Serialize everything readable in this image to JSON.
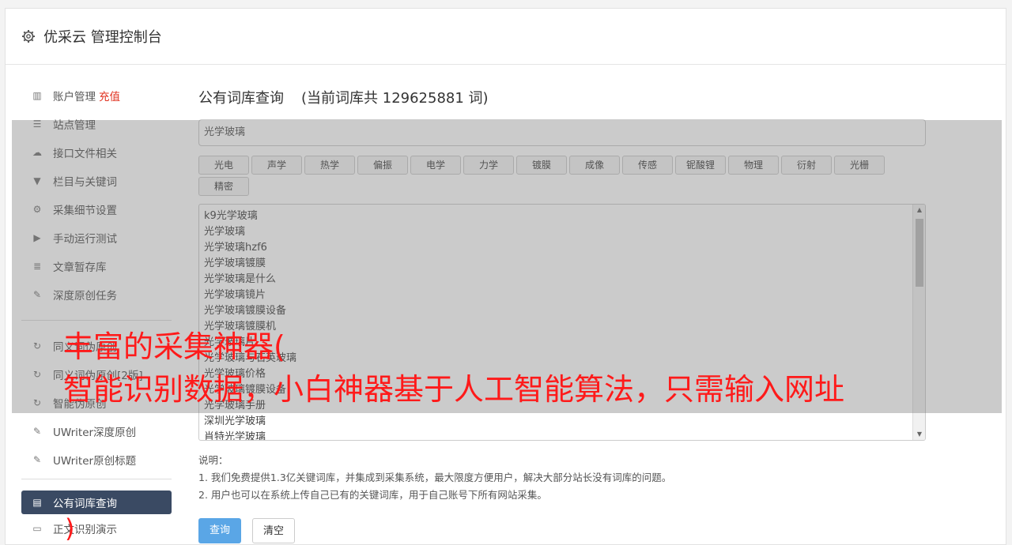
{
  "header": {
    "title": "优采云 管理控制台",
    "icon": "gear-icon"
  },
  "sidebar": {
    "account": {
      "label": "账户管理",
      "recharge": "充值",
      "icon": "bar-chart-icon"
    },
    "items": [
      {
        "label": "站点管理",
        "icon": "server-icon"
      },
      {
        "label": "接口文件相关",
        "icon": "cloud-upload-icon"
      },
      {
        "label": "栏目与关键词",
        "icon": "filter-icon"
      },
      {
        "label": "采集细节设置",
        "icon": "gears-icon"
      },
      {
        "label": "手动运行测试",
        "icon": "play-icon"
      },
      {
        "label": "文章暂存库",
        "icon": "database-icon"
      },
      {
        "label": "深度原创任务",
        "icon": "edit-icon"
      }
    ],
    "items2": [
      {
        "label": "同义词伪原创",
        "icon": "refresh-icon"
      },
      {
        "label": "同义词伪原创[2版]",
        "icon": "refresh-icon"
      },
      {
        "label": "智能伪原创",
        "icon": "refresh-icon"
      },
      {
        "label": "UWriter深度原创",
        "icon": "edit-icon"
      },
      {
        "label": "UWriter原创标题",
        "icon": "edit-icon"
      }
    ],
    "active": {
      "label": "公有词库查询",
      "icon": "book-icon"
    },
    "last": {
      "label": "正文识别演示",
      "icon": "monitor-icon"
    }
  },
  "main": {
    "title": "公有词库查询",
    "count": "(当前词库共 129625881 词)",
    "search_value": "光学玻璃",
    "tags": [
      "光电",
      "声学",
      "热学",
      "偏振",
      "电学",
      "力学",
      "镀膜",
      "成像",
      "传感",
      "铌酸锂",
      "物理",
      "衍射",
      "光栅",
      "精密"
    ],
    "results": [
      "k9光学玻璃",
      "光学玻璃",
      "光学玻璃hzf6",
      "光学玻璃镀膜",
      "光学玻璃是什么",
      "光学玻璃镜片",
      "光学玻璃镀膜设备",
      "光学玻璃镀膜机",
      "光学玻璃片",
      "光学玻璃与石英玻璃",
      "光学玻璃价格",
      "光学玻璃镀膜设备",
      "光学玻璃手册",
      "深圳光学玻璃",
      "肖特光学玻璃"
    ],
    "notes_title": "说明：",
    "notes": [
      "1. 我们免费提供1.3亿关键词库，并集成到采集系统，最大限度方便用户，解决大部分站长没有词库的问题。",
      "2. 用户也可以在系统上传自己已有的关键词库，用于自己账号下所有网站采集。"
    ],
    "query_btn": "查询",
    "clear_btn": "清空"
  },
  "overlay": {
    "line1": "丰富的采集神器(",
    "line2": "智能识别数据，小白神器基于人工智能算法，只需输入网址",
    "tail": ")"
  }
}
